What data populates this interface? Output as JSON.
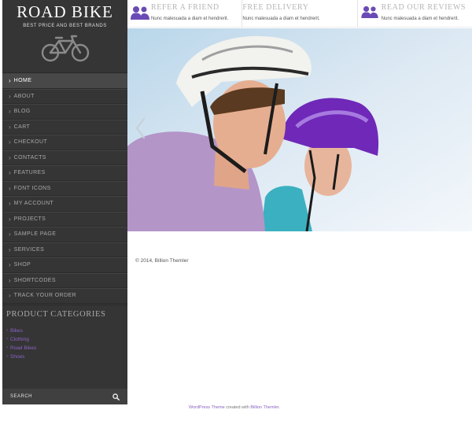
{
  "brand": {
    "title": "ROAD BIKE",
    "tagline": "BEST PRICE AND BEST BRANDS"
  },
  "menu": [
    {
      "label": "HOME",
      "active": true
    },
    {
      "label": "ABOUT"
    },
    {
      "label": "BLOG"
    },
    {
      "label": "CART"
    },
    {
      "label": "CHECKOUT"
    },
    {
      "label": "CONTACTS"
    },
    {
      "label": "FEATURES"
    },
    {
      "label": "FONT ICONS"
    },
    {
      "label": "MY ACCOUNT"
    },
    {
      "label": "PROJECTS"
    },
    {
      "label": "SAMPLE PAGE"
    },
    {
      "label": "SERVICES"
    },
    {
      "label": "SHOP"
    },
    {
      "label": "SHORTCODES"
    },
    {
      "label": "TRACK YOUR ORDER"
    }
  ],
  "categories": {
    "title": "PRODUCT CATEGORIES",
    "items": [
      "Bikes",
      "Clothing",
      "Road Bikes",
      "Shoes"
    ]
  },
  "search": {
    "label": "SEARCH"
  },
  "features": [
    {
      "title": "REFER A FRIEND",
      "desc": "Nunc malesuada a diam et hendrerit."
    },
    {
      "title": "FREE DELIVERY",
      "desc": "Nunc malesuada a diam et hendrerit."
    },
    {
      "title": "READ OUR REVIEWS",
      "desc": "Nunc malesuada a diam et hendrerit."
    }
  ],
  "copyright": "© 2014, Billion Themler",
  "footer": {
    "link1": "WordPress Theme",
    "mid": "created with",
    "link2": "Billion Themler."
  },
  "colors": {
    "accent": "#8b62c4",
    "sidebar": "#353535"
  }
}
